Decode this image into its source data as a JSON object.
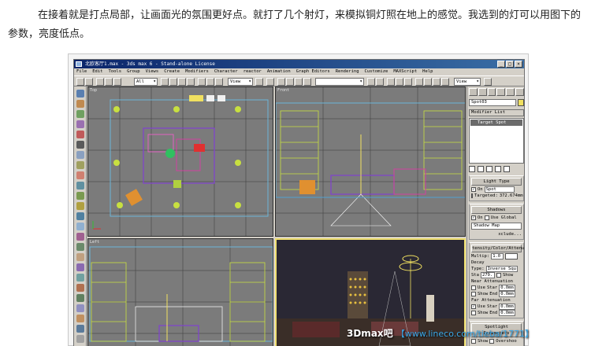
{
  "article": {
    "paragraph": "在接着就是打点局部，让画面光的氛围更好点。就打了几个射灯，来模拟铜灯照在地上的感觉。我选到的灯可以用图下的参数，亮度低点。"
  },
  "max_window": {
    "title": "北欧客厅1.max - 3ds max 6 - Stand-alone License",
    "window_buttons": [
      "_",
      "□",
      "×"
    ],
    "menu": [
      "File",
      "Edit",
      "Tools",
      "Group",
      "Views",
      "Create",
      "Modifiers",
      "Character",
      "reactor",
      "Animation",
      "Graph Editors",
      "Rendering",
      "Customize",
      "MAXScript",
      "Help"
    ],
    "toolbar": {
      "selection_filter": "All",
      "ref_coord": "View",
      "named_selection": "",
      "view_dropdown": "View"
    },
    "viewports": [
      {
        "label": "Top"
      },
      {
        "label": "Front"
      },
      {
        "label": "Left"
      },
      {
        "label": ""
      }
    ],
    "command_panel": {
      "object_name": "Spot03",
      "object_color": "#f0e060",
      "modifier_list": "Modifier List",
      "stack_item": "Target Spot",
      "light_type": {
        "title": "Light Type",
        "on_label": "On",
        "on_checked": "✓",
        "type_value": "Spot",
        "targeted_label": "Targeted:",
        "targeted_value": "372.674mm"
      },
      "shadows": {
        "title": "Shadows",
        "on_label": "On",
        "on_checked": "✓",
        "use_global_label": "Use Global",
        "shadow_type": "Shadow Map",
        "exclude_button": "xclude..."
      },
      "intensity": {
        "title": "tensity/Color/Attenuat",
        "multiplier_label": "Multip:",
        "multiplier_value": "1.0",
        "decay_title": "Decay",
        "decay_type_label": "Type:",
        "decay_type_value": "Inverse Squ",
        "start_label": "Sta",
        "start_value": "279.",
        "show_label": "Show"
      },
      "near_atten": {
        "title": "Near Attenuation",
        "use_label": "Use",
        "show_label": "Show",
        "start_label": "Star",
        "start_value": "0.0mm",
        "end_label": "End",
        "end_value": "0.0mm"
      },
      "far_atten": {
        "title": "Far Attenuation",
        "use_label": "Use",
        "use_checked": "✓",
        "show_label": "Show",
        "start_label": "Star",
        "start_value": "0.0mm",
        "end_label": "End",
        "end_value": "0.0mm"
      },
      "spotlight_params": {
        "title": "Spotlight Parameters",
        "show_label": "Show",
        "overshoot_label": "Overshoo"
      }
    }
  },
  "watermark": {
    "brand": "3Dmax吧",
    "site": "【www.lineco.com/tieba/1771】"
  },
  "colors": {
    "viewport_bg": "#7b7b7b",
    "active_border": "#f0e070",
    "ui_gray": "#d4d0c8",
    "title_blue": "#0a246a"
  }
}
